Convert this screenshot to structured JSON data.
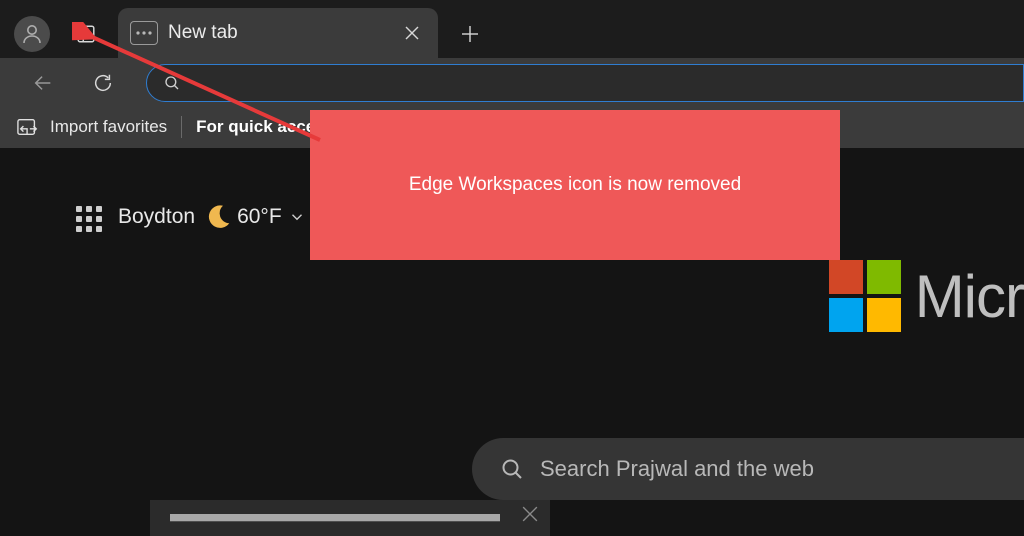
{
  "tab": {
    "title": "New tab"
  },
  "favbar": {
    "import": "Import favorites",
    "quickAccess": "For quick access"
  },
  "weather": {
    "city": "Boydton",
    "temp": "60°F"
  },
  "logo": {
    "text": "Micr"
  },
  "ntpSearch": {
    "placeholder": "Search Prajwal and the web"
  },
  "annotation": {
    "text": "Edge Workspaces icon is now removed"
  }
}
